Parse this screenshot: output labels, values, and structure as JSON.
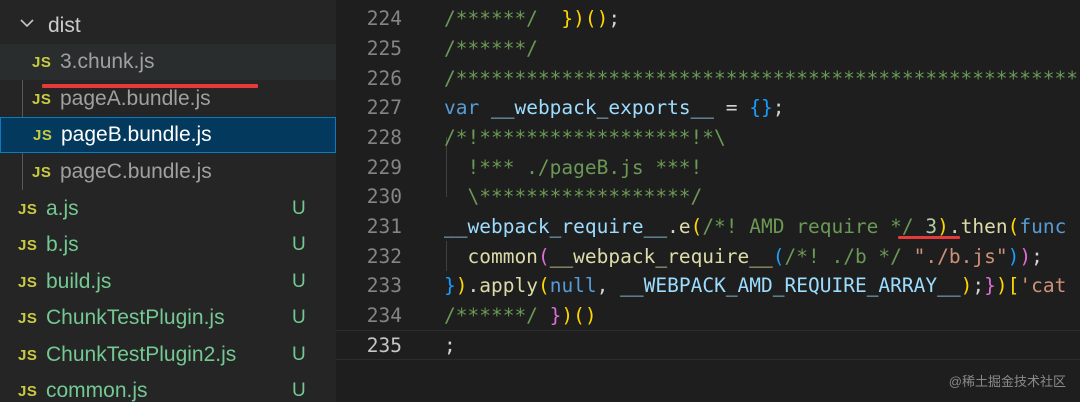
{
  "explorer": {
    "folder": "dist",
    "dist_files": [
      {
        "icon": "JS",
        "name": "3.chunk.js"
      },
      {
        "icon": "JS",
        "name": "pageA.bundle.js"
      },
      {
        "icon": "JS",
        "name": "pageB.bundle.js"
      },
      {
        "icon": "JS",
        "name": "pageC.bundle.js"
      }
    ],
    "files": [
      {
        "icon": "JS",
        "name": "a.js",
        "status": "U"
      },
      {
        "icon": "JS",
        "name": "b.js",
        "status": "U"
      },
      {
        "icon": "JS",
        "name": "build.js",
        "status": "U"
      },
      {
        "icon": "JS",
        "name": "ChunkTestPlugin.js",
        "status": "U"
      },
      {
        "icon": "JS",
        "name": "ChunkTestPlugin2.js",
        "status": "U"
      },
      {
        "icon": "JS",
        "name": "common.js",
        "status": "U"
      }
    ]
  },
  "editor": {
    "line_numbers": [
      "224",
      "225",
      "226",
      "227",
      "228",
      "229",
      "230",
      "231",
      "232",
      "233",
      "234",
      "235"
    ],
    "lines": {
      "l224": {
        "a": "/******/",
        "b": "  ",
        "c": "})",
        "d": "()",
        "e": ";"
      },
      "l225": {
        "a": "/******/"
      },
      "l226": {
        "a": "/*****************************************************"
      },
      "l227": {
        "a": "var",
        "b": " ",
        "c": "__webpack_exports__",
        "d": " = ",
        "e": "{}",
        "f": ";"
      },
      "l228": {
        "a": "/*!******************!*\\"
      },
      "l229": {
        "a": "  !*** ./pageB.js ***!"
      },
      "l230": {
        "a": "  \\******************/"
      },
      "l231": {
        "a": "__webpack_require__",
        "b": ".",
        "c": "e",
        "d": "(",
        "e": "/*! AMD require */",
        "f": " ",
        "g": "3",
        "h": ")",
        "i": ".",
        "j": "then",
        "k": "(",
        "l": "func"
      },
      "l232": {
        "a": "  ",
        "b": "common",
        "c": "(",
        "d": "__webpack_require__",
        "e": "(",
        "f": "/*! ./b */",
        "g": " ",
        "h": "\"./b.js\"",
        "i": ")",
        "j": ")",
        "k": ";"
      },
      "l233": {
        "a": "}",
        "b": ")",
        "c": ".",
        "d": "apply",
        "e": "(",
        "f": "null",
        "g": ", ",
        "h": "__WEBPACK_AMD_REQUIRE_ARRAY__",
        "i": ")",
        "j": ";",
        "k": "}",
        "l": ")",
        "m": "[",
        "n": "'cat"
      },
      "l234": {
        "a": "/******/",
        "b": " ",
        "c": "}",
        "d": ")",
        "e": "()"
      },
      "l235": {
        "a": ";"
      }
    }
  },
  "watermark": "@稀土掘金技术社区",
  "colors": {
    "accent_underline": "#e5393a",
    "js_icon": "#cbcb41",
    "untracked": "#73c991",
    "selection": "#04395e"
  }
}
